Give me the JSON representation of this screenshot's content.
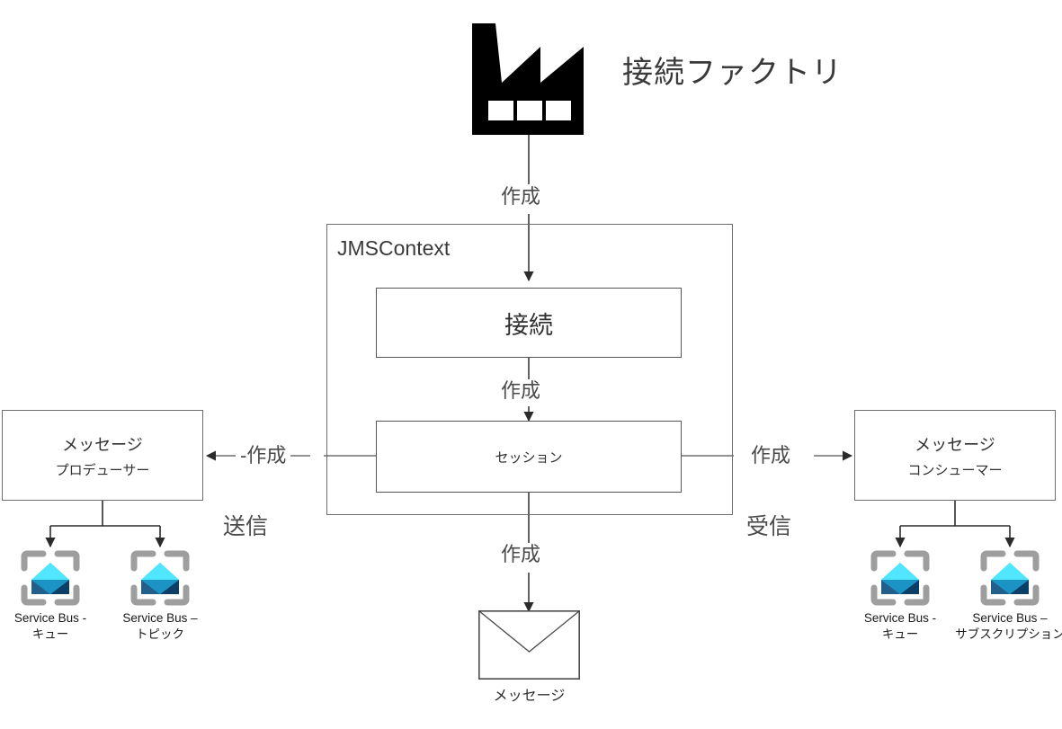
{
  "diagram": {
    "title": "接続ファクトリ",
    "factory_icon": "factory-icon"
  },
  "context": {
    "label": "JMSContext",
    "connection": {
      "label": "接続"
    },
    "session": {
      "label": "セッション"
    }
  },
  "edges": {
    "factory_to_context": "作成",
    "connection_to_session": "作成",
    "session_to_producer": "-作成",
    "session_to_consumer": "作成",
    "session_to_message": "作成",
    "producer_action": "送信",
    "consumer_action": "受信"
  },
  "producer": {
    "title": "メッセージ",
    "subtitle": "プロデューサー",
    "targets": [
      {
        "icon": "service-bus-icon",
        "line1": "Service Bus -",
        "line2": "キュー"
      },
      {
        "icon": "service-bus-icon",
        "line1": "Service Bus –",
        "line2": "トピック"
      }
    ]
  },
  "consumer": {
    "title": "メッセージ",
    "subtitle": "コンシューマー",
    "targets": [
      {
        "icon": "service-bus-icon",
        "line1": "Service Bus -",
        "line2": "キュー"
      },
      {
        "icon": "service-bus-icon",
        "line1": "Service Bus –",
        "line2": "サブスクリプション"
      }
    ]
  },
  "message": {
    "icon": "envelope-icon",
    "label": "メッセージ"
  },
  "colors": {
    "stroke": "#3a3a3a",
    "box_border": "#6e6e6e",
    "text": "#3a3a3a",
    "icon_bracket": "#9e9e9e",
    "icon_top": "#50e6ff",
    "icon_left": "#32bedd",
    "icon_right": "#1b93c4",
    "icon_bottom_left": "#225f8a",
    "icon_bottom_right": "#0b3f66",
    "background": "#ffffff"
  }
}
